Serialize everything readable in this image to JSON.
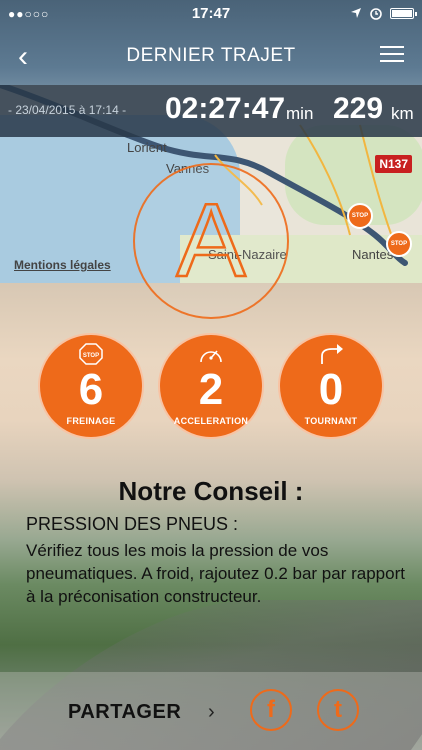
{
  "status": {
    "dots": "●●○○○",
    "time": "17:47"
  },
  "nav": {
    "back": "‹",
    "title": "DERNIER TRAJET"
  },
  "trip": {
    "date": "- 23/04/2015 à 17:14 -",
    "duration": "02:27:47",
    "duration_unit": "min",
    "distance": "229",
    "distance_unit": "km"
  },
  "map": {
    "labels": {
      "lorient": "Lorient",
      "vannes": "Vannes",
      "saint_nazaire": "Saint-Nazaire",
      "nantes": "Nantes",
      "road": "N137"
    },
    "legal": "Mentions légales",
    "stop_pin": "STOP"
  },
  "grade": {
    "letter": "A"
  },
  "stats": [
    {
      "value": "6",
      "label": "FREINAGE",
      "icon": "stop-icon"
    },
    {
      "value": "2",
      "label": "ACCELERATION",
      "icon": "speedometer-icon"
    },
    {
      "value": "0",
      "label": "TOURNANT",
      "icon": "turn-arrow-icon"
    }
  ],
  "advice": {
    "title": "Notre Conseil :",
    "subtitle": "PRESSION DES PNEUS :",
    "text": "Vérifiez tous les mois la pression de vos pneumatiques. A froid, rajoutez 0.2 bar par rapport à la préconisation constructeur."
  },
  "share": {
    "label": "PARTAGER",
    "arrow": "›",
    "facebook": "f",
    "twitter": "t"
  },
  "colors": {
    "accent": "#ee6a1a",
    "bar": "#283748"
  }
}
